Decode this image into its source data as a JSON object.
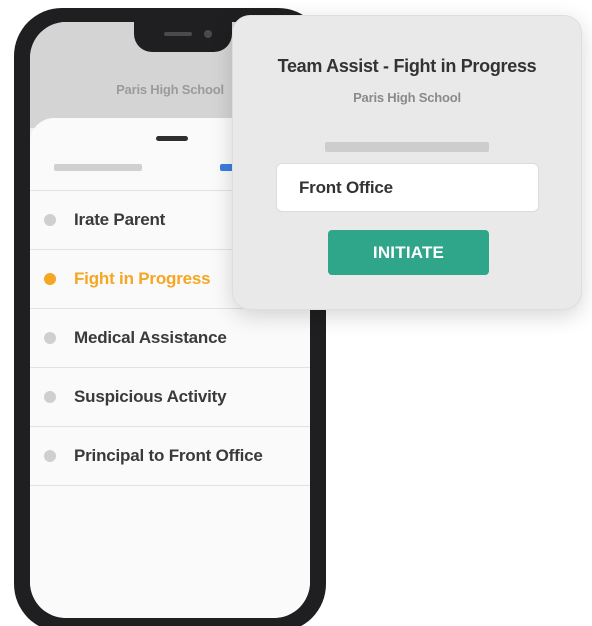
{
  "phone": {
    "school_name": "Paris High School",
    "alerts": [
      {
        "label": "Irate Parent",
        "status": "inactive"
      },
      {
        "label": "Fight in Progress",
        "status": "active"
      },
      {
        "label": "Medical Assistance",
        "status": "inactive"
      },
      {
        "label": "Suspicious Activity",
        "status": "inactive"
      },
      {
        "label": "Principal to Front Office",
        "status": "inactive"
      }
    ]
  },
  "modal": {
    "title": "Team Assist - Fight in Progress",
    "subtitle": "Paris High School",
    "location_value": "Front Office",
    "initiate_label": "INITIATE"
  },
  "colors": {
    "accent_orange": "#f5a623",
    "initiate_green": "#2fa58a",
    "tab_blue": "#3b7ddd",
    "phone_frame": "#1f1f21"
  }
}
